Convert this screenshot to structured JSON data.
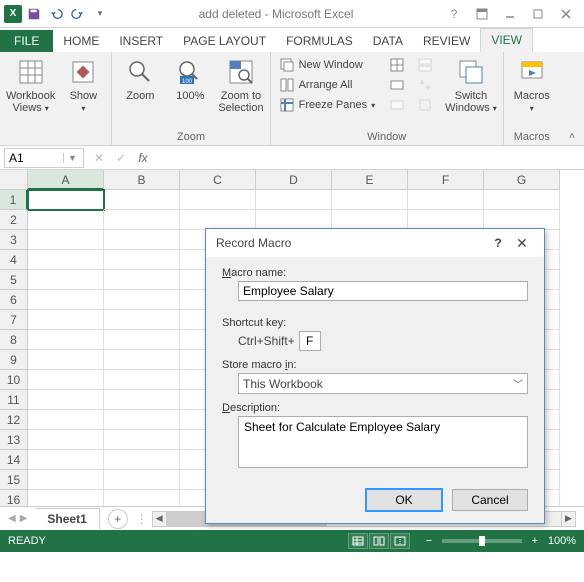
{
  "title": "add deleted - Microsoft Excel",
  "tabs": {
    "file": "FILE",
    "list": [
      "HOME",
      "INSERT",
      "PAGE LAYOUT",
      "FORMULAS",
      "DATA",
      "REVIEW",
      "VIEW"
    ],
    "active": "VIEW"
  },
  "ribbon": {
    "workbook_views": "Workbook\nViews",
    "show": "Show",
    "zoom": "Zoom",
    "pct100": "100%",
    "zoom_sel": "Zoom to\nSelection",
    "zoom_group": "Zoom",
    "new_window": "New Window",
    "arrange_all": "Arrange All",
    "freeze_panes": "Freeze Panes",
    "switch_windows": "Switch\nWindows",
    "window_group": "Window",
    "macros": "Macros",
    "macros_group": "Macros"
  },
  "namebox": "A1",
  "columns": [
    "A",
    "B",
    "C",
    "D",
    "E",
    "F",
    "G"
  ],
  "rows": [
    "1",
    "2",
    "3",
    "4",
    "5",
    "6",
    "7",
    "8",
    "9",
    "10",
    "11",
    "12",
    "13",
    "14",
    "15",
    "16"
  ],
  "sheet_tab": "Sheet1",
  "status": {
    "ready": "READY",
    "zoom": "100%"
  },
  "dialog": {
    "title": "Record Macro",
    "macro_name_label_pre": "M",
    "macro_name_label_rest": "acro name:",
    "macro_name": "Employee Salary",
    "shortcut_label": "Shortcut key:",
    "shortcut_prefix": "Ctrl+Shift+",
    "shortcut_key": "F",
    "store_label_pre": "Store macro ",
    "store_label_u": "i",
    "store_label_post": "n:",
    "store_value": "This Workbook",
    "desc_label_pre": "D",
    "desc_label_rest": "escription:",
    "desc": "Sheet for Calculate Employee Salary",
    "ok": "OK",
    "cancel": "Cancel"
  }
}
